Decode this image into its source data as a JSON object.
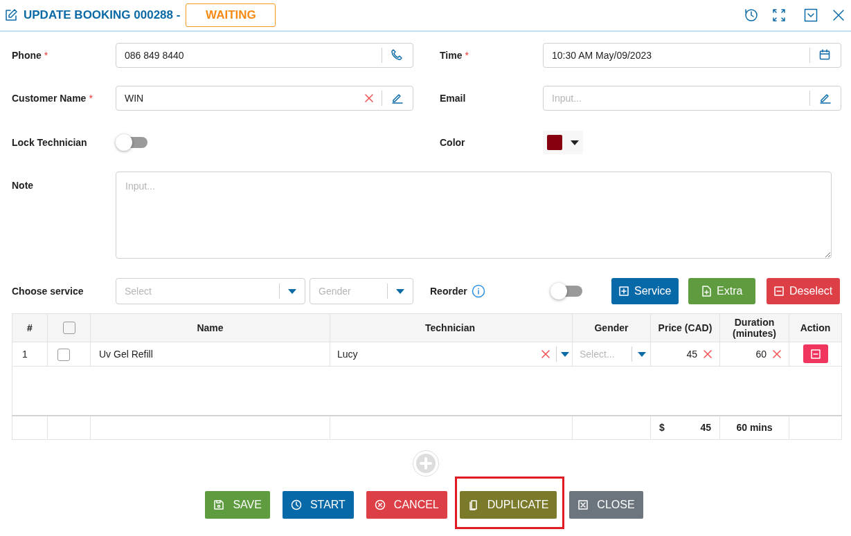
{
  "header": {
    "title": "UPDATE BOOKING 000288 -",
    "status": "WAITING"
  },
  "phone": {
    "label": "Phone",
    "required_mark": "*",
    "value": "086 849 8440"
  },
  "time": {
    "label": "Time",
    "required_mark": "*",
    "value": "10:30 AM May/09/2023"
  },
  "customer_name": {
    "label": "Customer Name",
    "required_mark": "*",
    "value": "WIN",
    "clearable": true
  },
  "email": {
    "label": "Email",
    "placeholder": "Input..."
  },
  "lock_technician": {
    "label": "Lock Technician",
    "on": false
  },
  "color": {
    "label": "Color",
    "color": "#86000f"
  },
  "note": {
    "label": "Note",
    "placeholder": "Input..."
  },
  "choose_service": {
    "label": "Choose service",
    "service_placeholder": "Select",
    "gender_placeholder": "Gender"
  },
  "reorder": {
    "label": "Reorder",
    "on": false
  },
  "service_buttons": [
    {
      "kind": "service",
      "label": "Service"
    },
    {
      "kind": "extra",
      "label": "Extra"
    },
    {
      "kind": "deselect",
      "label": "Deselect"
    }
  ],
  "table": {
    "columns": [
      "#",
      "Name",
      "Technician",
      "Gender",
      "Price (CAD)",
      "Duration (minutes)",
      "Action"
    ],
    "select_all_checked": false,
    "rows": [
      {
        "index": "1",
        "checked": false,
        "name": "Uv Gel Refill",
        "technician": "Lucy",
        "gender_placeholder": "Select...",
        "price": "45",
        "duration": "60"
      }
    ],
    "totals": {
      "currency": "$",
      "price": "45",
      "duration": "60 mins"
    }
  },
  "actions": [
    {
      "kind": "save",
      "label": "SAVE",
      "highlighted": false
    },
    {
      "kind": "start",
      "label": "START",
      "highlighted": false
    },
    {
      "kind": "cancel",
      "label": "CANCEL",
      "highlighted": false
    },
    {
      "kind": "duplicate",
      "label": "DUPLICATE",
      "highlighted": true
    },
    {
      "kind": "close",
      "label": "CLOSE",
      "highlighted": false
    }
  ]
}
